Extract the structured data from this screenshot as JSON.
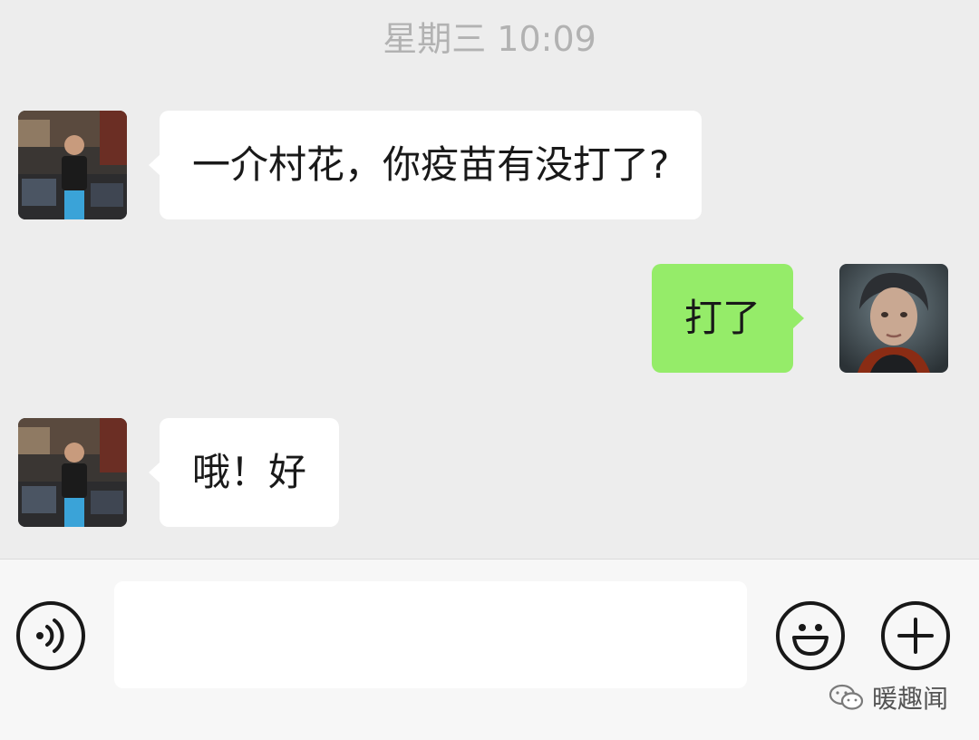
{
  "chat": {
    "timestamp": "星期三 10:09",
    "messages": [
      {
        "sender": "other",
        "text": "一介村花，你疫苗有没打了?"
      },
      {
        "sender": "self",
        "text": "打了"
      },
      {
        "sender": "other",
        "text": "哦！好"
      }
    ]
  },
  "input_bar": {
    "voice_icon": "voice-icon",
    "input_value": "",
    "emoji_icon": "emoji-icon",
    "plus_icon": "plus-icon"
  },
  "watermark": {
    "text": "暖趣闻",
    "icon": "wechat-icon"
  },
  "colors": {
    "background": "#ededed",
    "incoming_bubble": "#ffffff",
    "outgoing_bubble": "#95ec69",
    "timestamp": "#b2b2b2"
  }
}
